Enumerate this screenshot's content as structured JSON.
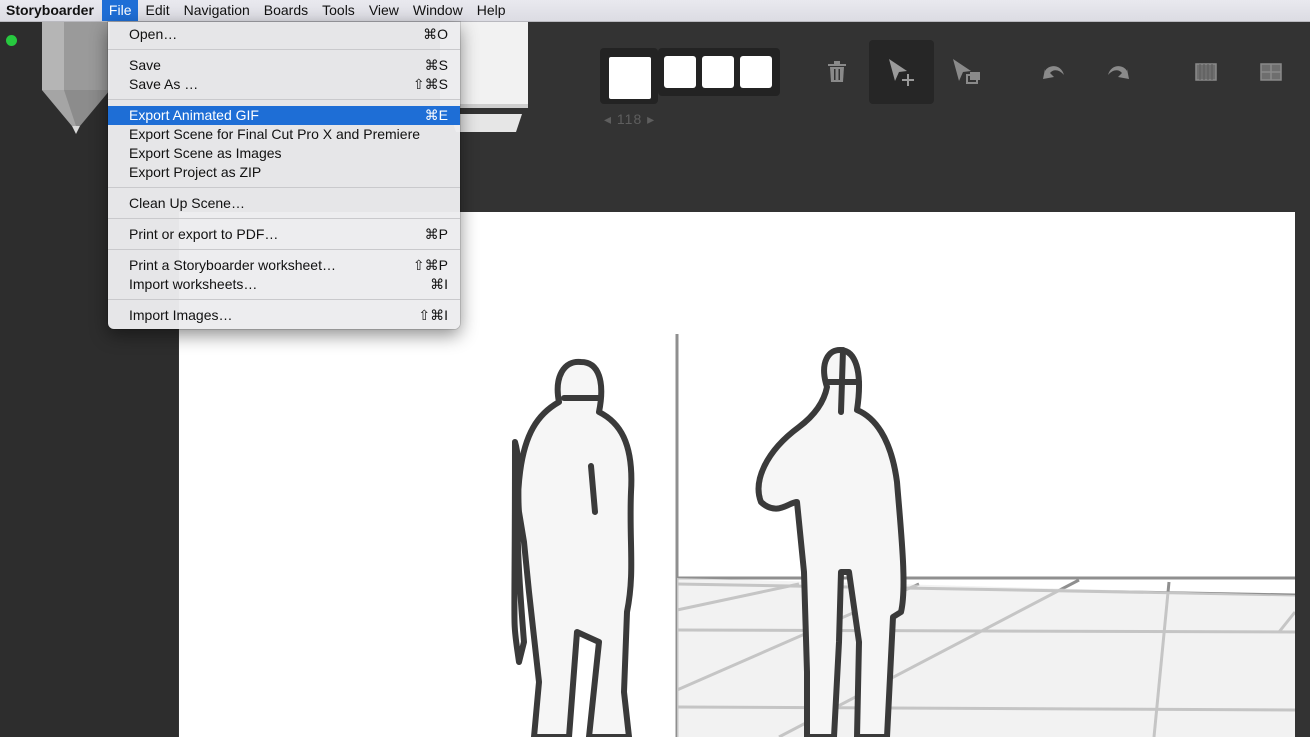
{
  "menubar": {
    "items": [
      "Storyboarder",
      "File",
      "Edit",
      "Navigation",
      "Boards",
      "Tools",
      "View",
      "Window",
      "Help"
    ],
    "active": "File"
  },
  "file_menu": {
    "items": [
      {
        "label": "Open…",
        "shortcut": "⌘O"
      },
      {
        "label": "Save",
        "shortcut": "⌘S"
      },
      {
        "label": "Save As …",
        "shortcut": "⇧⌘S"
      },
      {
        "label": "Export Animated GIF",
        "shortcut": "⌘E",
        "highlighted": true
      },
      {
        "label": "Export Scene for Final Cut Pro X and Premiere",
        "shortcut": ""
      },
      {
        "label": "Export Scene as Images",
        "shortcut": ""
      },
      {
        "label": "Export Project as ZIP",
        "shortcut": ""
      },
      {
        "label": "Clean Up Scene…",
        "shortcut": ""
      },
      {
        "label": "Print or export to PDF…",
        "shortcut": "⌘P"
      },
      {
        "label": "Print a Storyboarder worksheet…",
        "shortcut": "⇧⌘P"
      },
      {
        "label": "Import worksheets…",
        "shortcut": "⌘I"
      },
      {
        "label": "Import Images…",
        "shortcut": "⇧⌘I"
      }
    ]
  },
  "frame_counter": "◂ 118 ▸",
  "toolbar": {
    "icons": [
      "trash-icon",
      "move-pointer-icon",
      "copy-pointer-icon",
      "undo-icon",
      "redo-icon",
      "grid-icon",
      "quad-grid-icon"
    ],
    "selected": "move-pointer-icon"
  },
  "colors": {
    "menu_highlight": "#1e6ed6",
    "workspace": "#333333",
    "status_dot": "#27c93f"
  }
}
